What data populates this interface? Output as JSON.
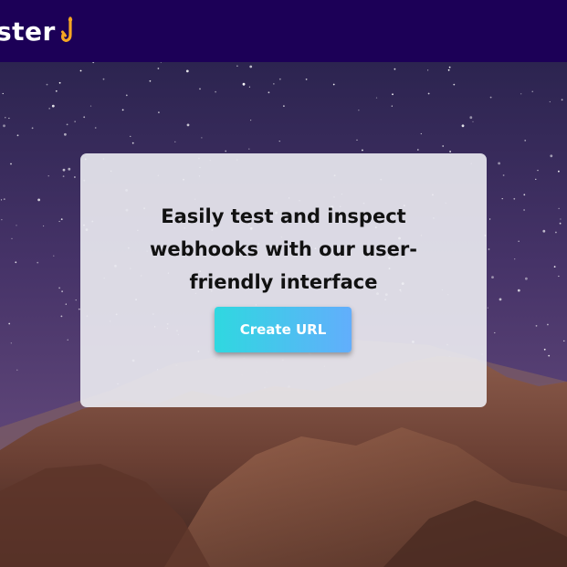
{
  "header": {
    "brand_text": "ster",
    "brand_icon": "hook-icon"
  },
  "hero": {
    "headline_line1": "Easily test and inspect",
    "headline_line2": "webhooks with our user-",
    "headline_line3": "friendly interface",
    "cta_label": "Create URL"
  },
  "colors": {
    "header_bg": "#1c0057",
    "hook_accent": "#f5a623",
    "button_gradient_start": "#2fd8e0",
    "button_gradient_end": "#62aefc",
    "card_bg": "#ececf2"
  },
  "background": {
    "description_icon": "night-sky-mountain-image"
  }
}
